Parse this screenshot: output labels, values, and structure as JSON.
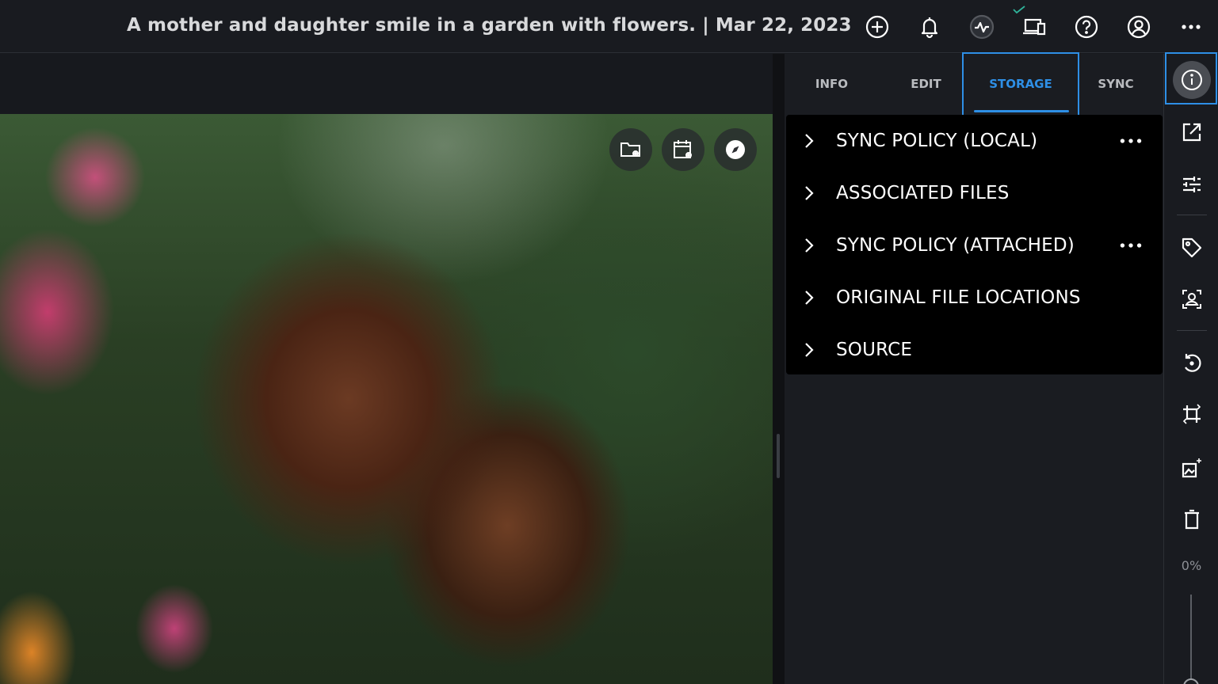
{
  "header": {
    "title": "A mother and daughter smile in a garden with flowers. | Mar 22, 2023",
    "icons": [
      "add-circle-icon",
      "bell-icon",
      "activity-icon",
      "devices-icon",
      "help-icon",
      "account-icon",
      "more-horizontal-icon"
    ]
  },
  "photo": {
    "overlay_buttons": [
      "folder-view-icon",
      "calendar-view-icon",
      "compass-icon"
    ]
  },
  "panel": {
    "tabs": [
      {
        "label": "INFO"
      },
      {
        "label": "EDIT"
      },
      {
        "label": "STORAGE"
      },
      {
        "label": "SYNC"
      }
    ],
    "active_tab": "STORAGE",
    "accent_color": "#2e8fe6",
    "sections": [
      {
        "label": "SYNC POLICY (LOCAL)",
        "has_menu": true
      },
      {
        "label": "ASSOCIATED FILES",
        "has_menu": false
      },
      {
        "label": "SYNC POLICY (ATTACHED)",
        "has_menu": true
      },
      {
        "label": "ORIGINAL FILE LOCATIONS",
        "has_menu": false
      },
      {
        "label": "SOURCE",
        "has_menu": false
      }
    ]
  },
  "toolbar": {
    "tools": [
      "info-icon",
      "open-external-icon",
      "adjustments-icon",
      "tag-icon",
      "face-recognition-icon",
      "rotate-icon",
      "crop-icon",
      "ai-enhance-icon",
      "trash-icon"
    ],
    "zoom_label": "0%",
    "zoom_value": 0
  }
}
